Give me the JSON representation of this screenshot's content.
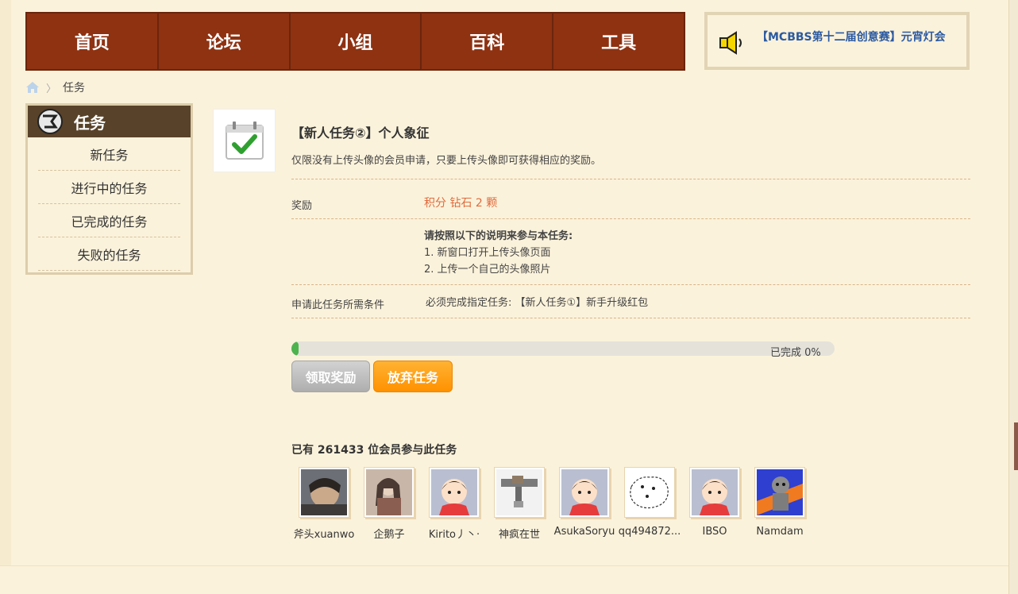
{
  "nav": {
    "items": [
      "首页",
      "论坛",
      "小组",
      "百科",
      "工具"
    ]
  },
  "announcement": {
    "icon": "speaker-icon",
    "text": "【MCBBS第十二届创意赛】元宵灯会"
  },
  "breadcrumb": {
    "home_icon": "home-icon",
    "current": "任务"
  },
  "sidebar": {
    "title": "任务",
    "items": [
      "新任务",
      "进行中的任务",
      "已完成的任务",
      "失败的任务"
    ]
  },
  "task": {
    "icon": "calendar-check-icon",
    "title": "【新人任务②】个人象征",
    "description": "仅限没有上传头像的会员申请，只要上传头像即可获得相应的奖励。",
    "reward_label": "奖励",
    "reward_value": "积分 钻石 2 颗",
    "instructions": {
      "heading": "请按照以下的说明来参与本任务:",
      "steps": [
        "1. 新窗口打开上传头像页面",
        "2. 上传一个自己的头像照片"
      ]
    },
    "condition_label": "申请此任务所需条件",
    "condition_value": "必须完成指定任务: 【新人任务①】新手升级红包",
    "progress_percent": 0,
    "progress_text": "已完成 0%",
    "claim_button": "领取奖励",
    "abandon_button": "放弃任务"
  },
  "participants": {
    "summary": "已有 261433 位会员参与此任务",
    "members": [
      {
        "name": "斧头xuanwo"
      },
      {
        "name": "企鹅子"
      },
      {
        "name": "Kirito丿丶·"
      },
      {
        "name": "神疯在世"
      },
      {
        "name": "AsukaSoryu"
      },
      {
        "name": "qq494872..."
      },
      {
        "name": "IBSO"
      },
      {
        "name": "Namdam"
      }
    ]
  },
  "colors": {
    "nav_bg": "#8e3212",
    "page_bg": "#fbf2db",
    "reward": "#e06b3d",
    "link": "#2b5aa2",
    "abandon_btn": "#ff9100",
    "progress_fill": "#4db34d"
  }
}
